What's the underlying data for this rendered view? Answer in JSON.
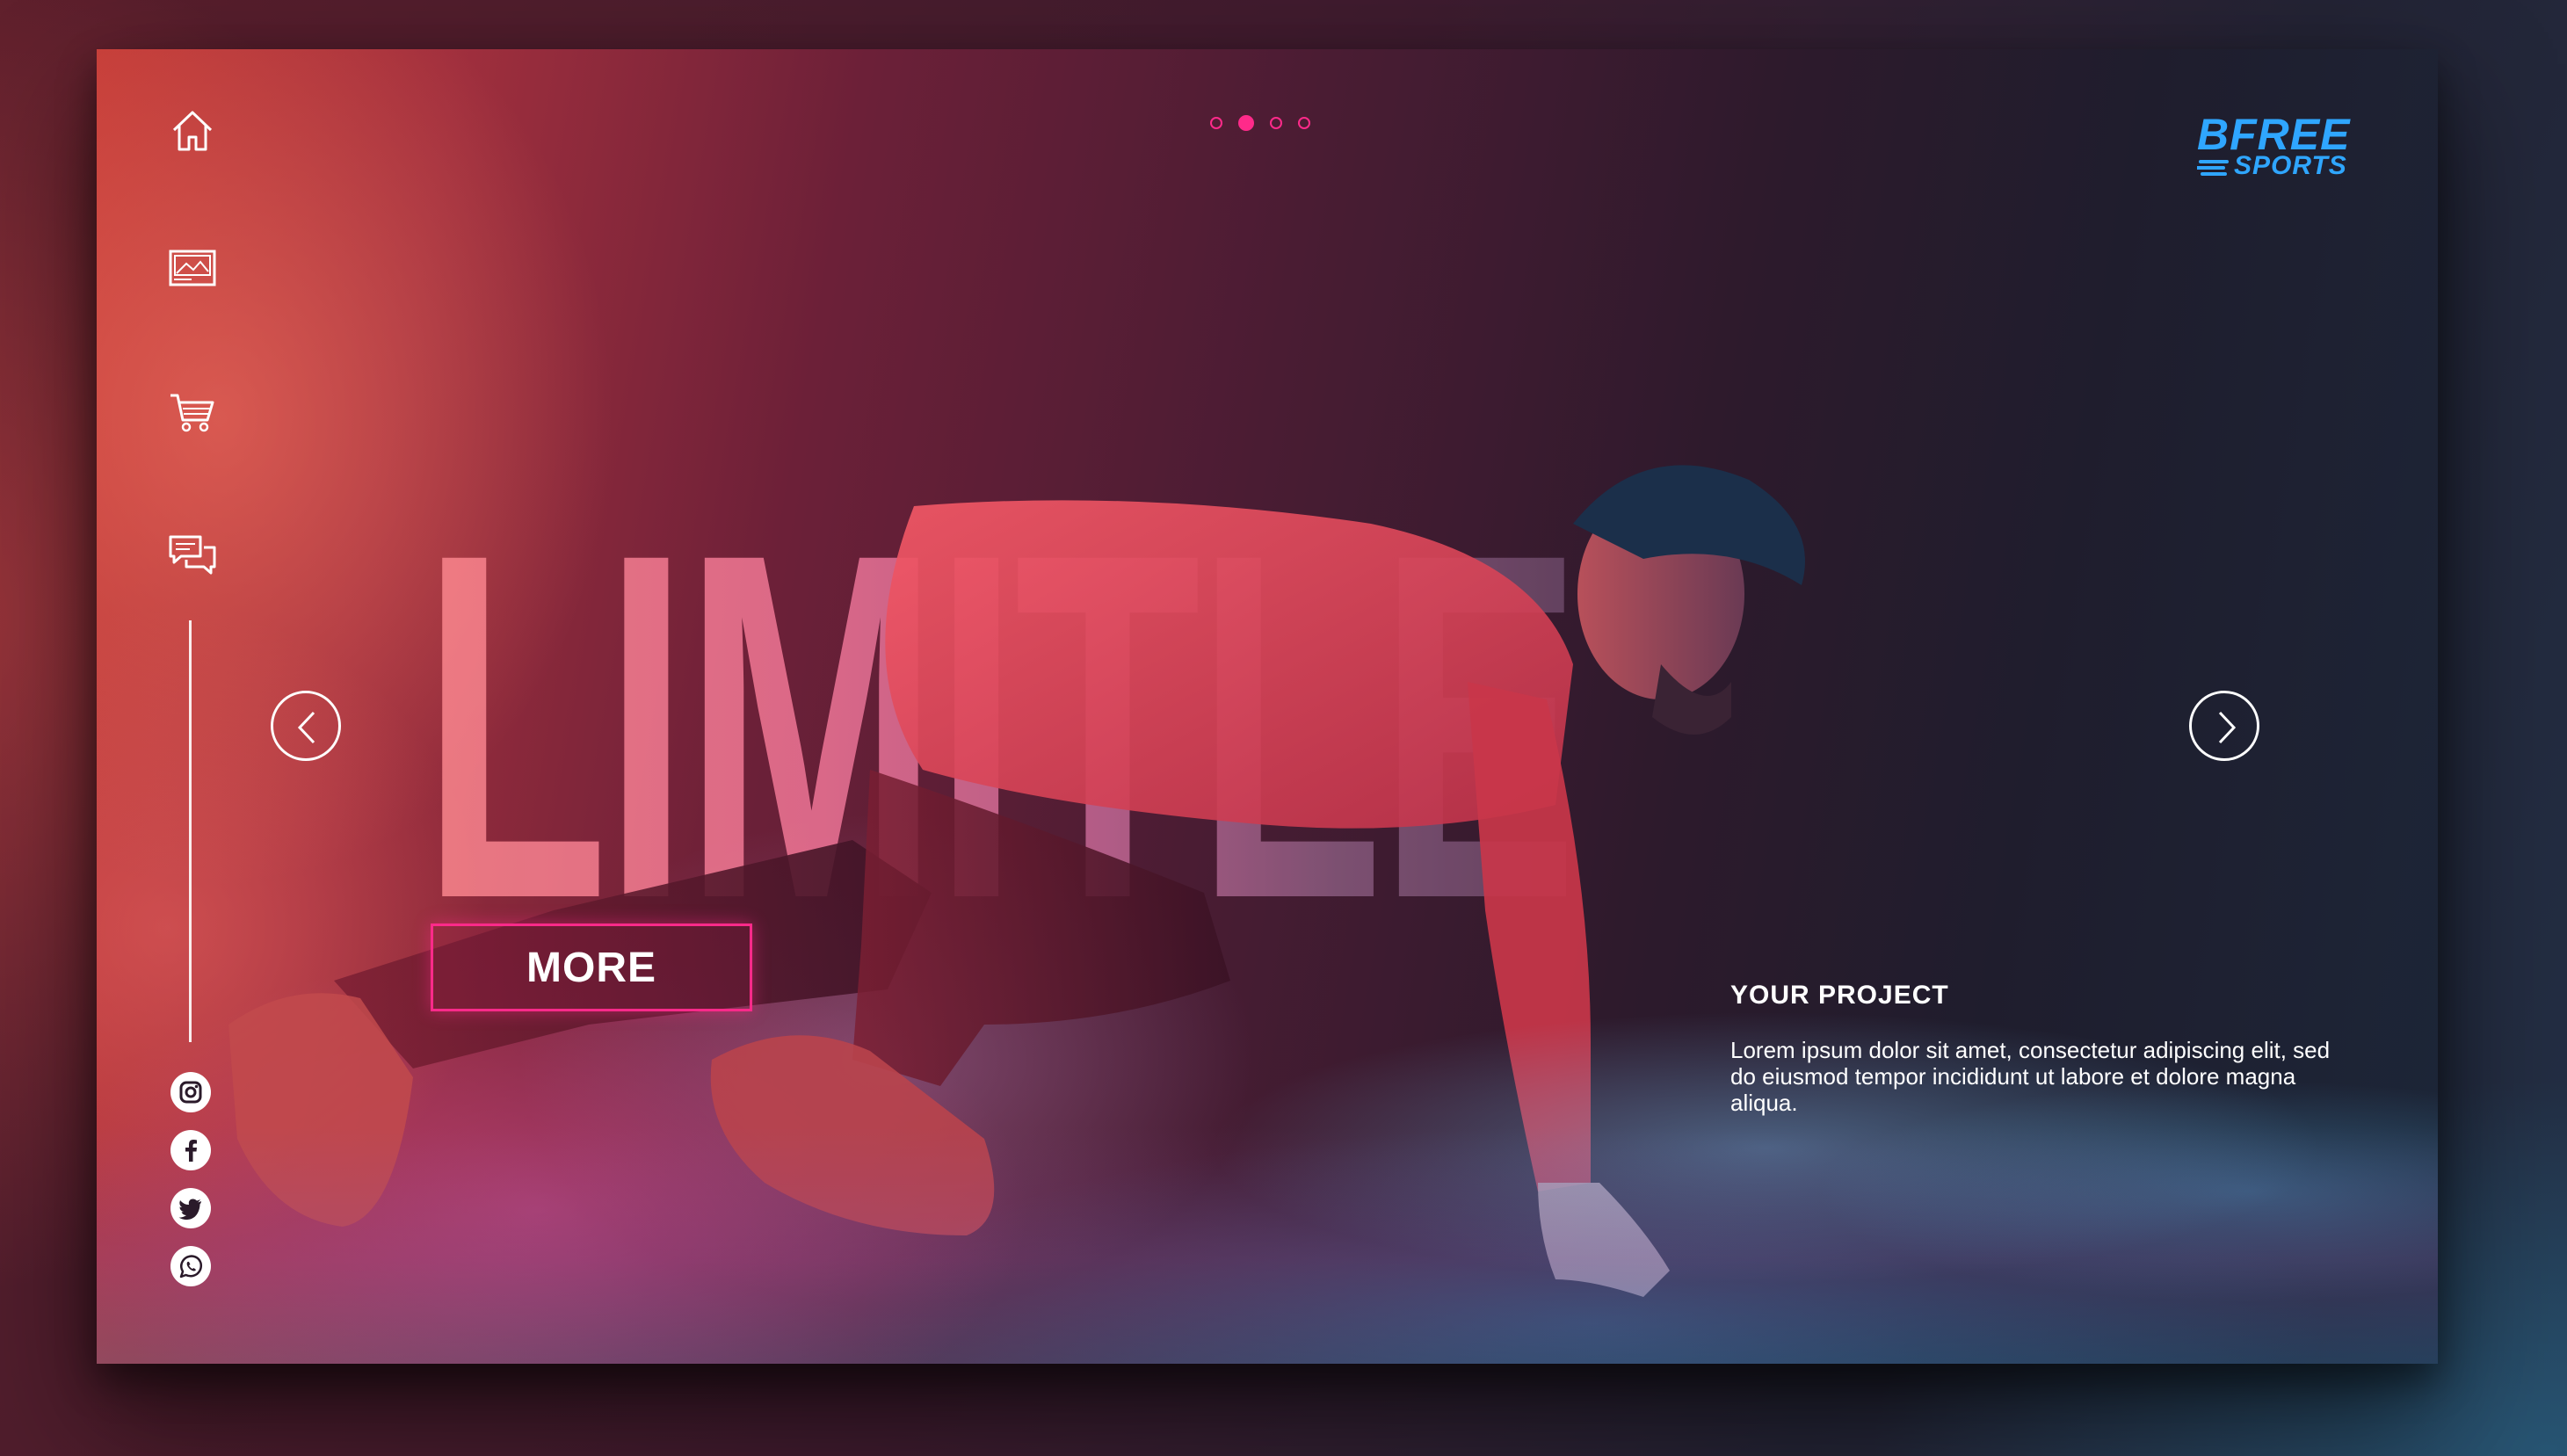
{
  "headline": "LIMITLESS",
  "brand": {
    "line1": "BFREE",
    "line2": "SPORTS",
    "color": "#2fa6ff"
  },
  "slider": {
    "total": 4,
    "active_index": 1,
    "accent": "#ff2a8a"
  },
  "cta": {
    "label": "MORE"
  },
  "project": {
    "title": "YOUR PROJECT",
    "body": "Lorem ipsum dolor sit amet, consectetur adipiscing elit, sed do eiusmod tempor incididunt ut labore et dolore magna aliqua."
  },
  "sidebar_icons": [
    "home-icon",
    "gallery-icon",
    "cart-icon",
    "chat-icon"
  ],
  "social_icons": [
    "instagram-icon",
    "facebook-icon",
    "twitter-icon",
    "whatsapp-icon"
  ],
  "arrows": [
    "arrow-left-icon",
    "arrow-right-icon"
  ]
}
